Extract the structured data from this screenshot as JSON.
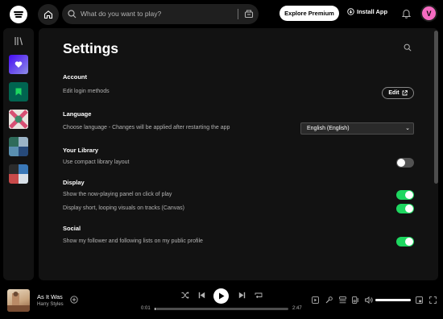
{
  "topbar": {
    "search_placeholder": "What do you want to play?",
    "explore_label": "Explore Premium",
    "install_label": "Install App",
    "avatar_initial": "V"
  },
  "settings": {
    "title": "Settings",
    "account": {
      "heading": "Account",
      "edit_login_text": "Edit login methods",
      "edit_label": "Edit"
    },
    "language": {
      "heading": "Language",
      "description": "Choose language - Changes will be applied after restarting the app",
      "selected": "English (English)"
    },
    "library": {
      "heading": "Your Library",
      "compact_text": "Use compact library layout",
      "compact_on": false
    },
    "display": {
      "heading": "Display",
      "now_playing_text": "Show the now-playing panel on click of play",
      "now_playing_on": true,
      "canvas_text": "Display short, looping visuals on tracks (Canvas)",
      "canvas_on": true
    },
    "social": {
      "heading": "Social",
      "follower_text": "Show my follower and following lists on my public profile",
      "follower_on": true
    }
  },
  "player": {
    "track_title": "As It Was",
    "artist": "Harry Styles",
    "elapsed": "0:01",
    "duration": "2:47",
    "progress_fraction": 0.006,
    "volume_fraction": 1.0
  },
  "colors": {
    "accent": "#1ed760",
    "background": "#121212",
    "avatar": "#f56bc1"
  }
}
